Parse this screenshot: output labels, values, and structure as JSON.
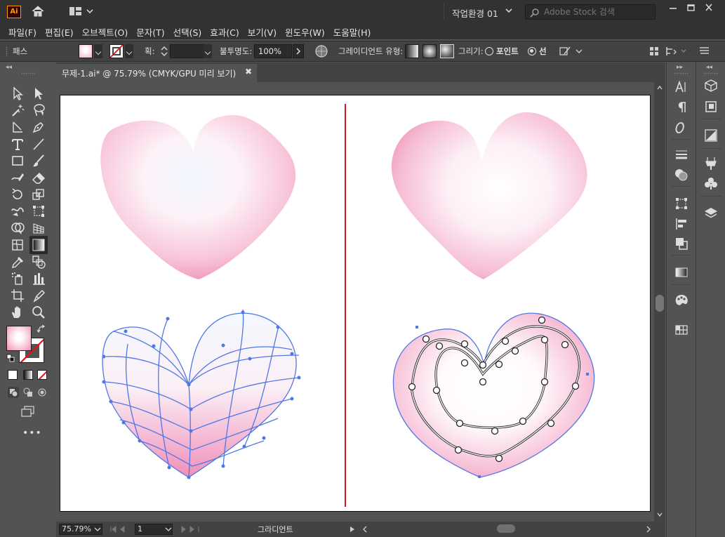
{
  "app": {
    "logo": "Ai"
  },
  "workspace": {
    "label": "작업환경 01"
  },
  "search": {
    "placeholder": "Adobe Stock 검색"
  },
  "menu": [
    "파일(F)",
    "편집(E)",
    "오브젝트(O)",
    "문자(T)",
    "선택(S)",
    "효과(C)",
    "보기(V)",
    "윈도우(W)",
    "도움말(H)"
  ],
  "control": {
    "selection_label": "패스",
    "stroke_label": "획:",
    "stroke_value": "",
    "opacity_label": "불투명도:",
    "opacity_value": "100%",
    "gradient_type_label": "그레이디언트 유형:",
    "draw_label": "그리기:",
    "draw_point": "포인트",
    "draw_line": "선"
  },
  "document": {
    "tab_title": "무제-1.ai* @ 75.79% (CMYK/GPU 미리 보기)"
  },
  "status": {
    "zoom": "75.79%",
    "artboard": "1",
    "tool_name": "그라디언트"
  },
  "colors": {
    "accent_red": "#d8161b",
    "mesh_blue": "#4f77e6",
    "heart_pink": "#f4aac6",
    "heart_light": "#fdf4fa"
  },
  "icons": {
    "toolbar": [
      "selection-tool-icon",
      "direct-selection-tool-icon",
      "magic-wand-icon",
      "lasso-icon",
      "line-segment-icon",
      "pen-tool-icon",
      "type-tool-icon",
      "line-tool-icon",
      "rectangle-tool-icon",
      "paintbrush-icon",
      "shaper-tool-icon",
      "eraser-icon",
      "rotate-tool-icon",
      "scale-tool-icon",
      "warp-tool-icon",
      "free-transform-icon",
      "shape-builder-icon",
      "perspective-grid-icon",
      "mesh-tool-icon",
      "gradient-tool-icon",
      "eyedropper-icon",
      "blend-tool-icon",
      "symbol-sprayer-icon",
      "graph-tool-icon",
      "artboard-tool-icon",
      "slice-tool-icon",
      "hand-tool-icon",
      "zoom-tool-icon"
    ],
    "right_dock_1": [
      "character-icon",
      "paragraph-icon",
      "opentype-icon",
      "stroke-icon",
      "transparency-icon",
      "transform-icon",
      "align-icon",
      "pathfinder-icon",
      "gradient-icon",
      "color-guide-icon",
      "swatches-icon"
    ],
    "right_dock_2": [
      "libraries-icon",
      "artboards-icon",
      "appearance-icon",
      "brushes-icon",
      "symbols-icon",
      "layers-icon"
    ]
  }
}
